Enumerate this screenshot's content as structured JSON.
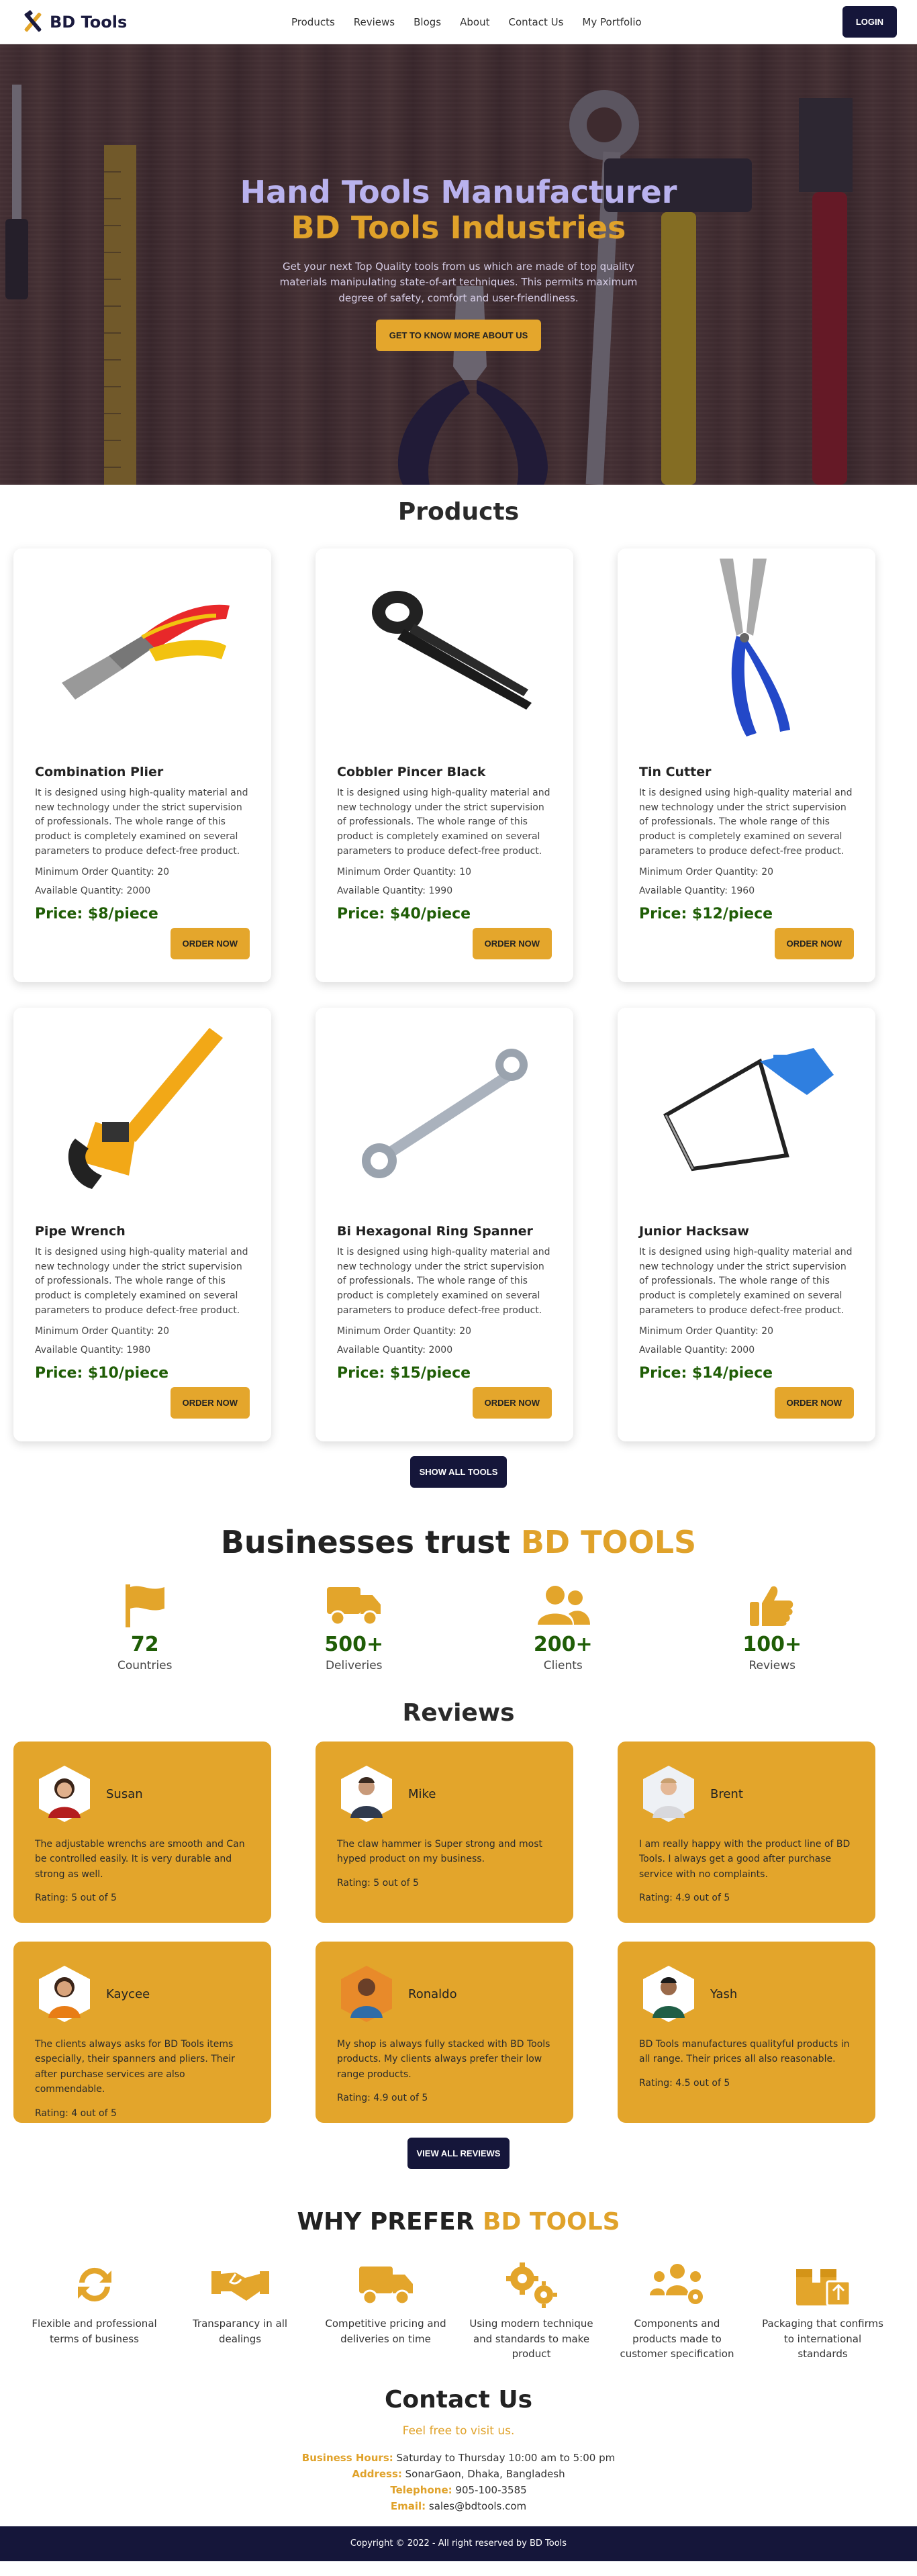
{
  "brand": {
    "name": "BD Tools"
  },
  "nav": {
    "links": [
      "Products",
      "Reviews",
      "Blogs",
      "About",
      "Contact Us",
      "My Portfolio"
    ],
    "login_label": "LOGIN"
  },
  "hero": {
    "title_line1": "Hand Tools Manufacturer",
    "title_line2": "BD Tools Industries",
    "description": "Get your next Top Quality tools from us which are made of top quality materials manipulating state-of-art techniques. This permits maximum degree of safety, comfort and user-friendliness.",
    "cta_label": "GET TO KNOW MORE ABOUT US"
  },
  "products": {
    "title": "Products",
    "order_label": "ORDER NOW",
    "min_order_prefix": "Minimum Order Quantity: ",
    "available_prefix": "Available Quantity: ",
    "description": "It is designed using high-quality material and new technology under the strict supervision of professionals. The whole range of this product is completely examined on several parameters to produce defect-free product.",
    "items": [
      {
        "name": "Combination Plier",
        "min_order": "20",
        "available": "2000",
        "price": "Price: $8/piece",
        "icon": "pliers-image"
      },
      {
        "name": "Cobbler Pincer Black",
        "min_order": "10",
        "available": "1990",
        "price": "Price: $40/piece",
        "icon": "pincer-image"
      },
      {
        "name": "Tin Cutter",
        "min_order": "20",
        "available": "1960",
        "price": "Price: $12/piece",
        "icon": "tin-cutter-image"
      },
      {
        "name": "Pipe Wrench",
        "min_order": "20",
        "available": "1980",
        "price": "Price: $10/piece",
        "icon": "pipe-wrench-image"
      },
      {
        "name": "Bi Hexagonal Ring Spanner",
        "min_order": "20",
        "available": "2000",
        "price": "Price: $15/piece",
        "icon": "ring-spanner-image"
      },
      {
        "name": "Junior Hacksaw",
        "min_order": "20",
        "available": "2000",
        "price": "Price: $14/piece",
        "icon": "hacksaw-image"
      }
    ],
    "show_all_label": "SHOW ALL TOOLS"
  },
  "trust": {
    "title_prefix": "Businesses trust ",
    "title_accent": "BD TOOLS",
    "stats": [
      {
        "value": "72",
        "label": "Countries",
        "icon": "flag-icon"
      },
      {
        "value": "500+",
        "label": "Deliveries",
        "icon": "truck-icon"
      },
      {
        "value": "200+",
        "label": "Clients",
        "icon": "users-icon"
      },
      {
        "value": "100+",
        "label": "Reviews",
        "icon": "thumbs-up-icon"
      }
    ]
  },
  "reviews": {
    "title": "Reviews",
    "items": [
      {
        "name": "Susan",
        "text": "The adjustable wrenchs are smooth and Can be controlled easily. It is very durable and strong as well.",
        "rating": "Rating: 5 out of 5"
      },
      {
        "name": "Mike",
        "text": "The claw hammer is Super strong and most hyped product on my business.",
        "rating": "Rating: 5 out of 5"
      },
      {
        "name": "Brent",
        "text": "I am really happy with the product line of BD Tools. I always get a good after purchase service with no complaints.",
        "rating": "Rating: 4.9 out of 5"
      },
      {
        "name": "Kaycee",
        "text": "The clients always asks for BD Tools items especially, their spanners and pliers. Their after purchase services are also commendable.",
        "rating": "Rating: 4 out of 5"
      },
      {
        "name": "Ronaldo",
        "text": "My shop is always fully stacked with BD Tools products. My clients always prefer their low range products.",
        "rating": "Rating: 4.9 out of 5"
      },
      {
        "name": "Yash",
        "text": "BD Tools manufactures qualityful products in all range. Their prices all also reasonable.",
        "rating": "Rating: 4.5 out of 5"
      }
    ],
    "view_all_label": "VIEW ALL REVIEWS"
  },
  "why": {
    "title_prefix": "WHY PREFER ",
    "title_accent": "BD TOOLS",
    "features": [
      {
        "label": "Flexible and professional terms of business",
        "icon": "refresh-icon"
      },
      {
        "label": "Transparancy in all dealings",
        "icon": "handshake-icon"
      },
      {
        "label": "Competitive pricing and deliveries on time",
        "icon": "truck-icon"
      },
      {
        "label": "Using modern technique and standards to make product",
        "icon": "gears-icon"
      },
      {
        "label": "Components and products made to customer specification",
        "icon": "users-gear-icon"
      },
      {
        "label": "Packaging that confirms to international standards",
        "icon": "package-icon"
      }
    ]
  },
  "contact": {
    "title": "Contact Us",
    "subtitle": "Feel free to visit us.",
    "hours_label": "Business Hours:",
    "hours_value": " Saturday to Thursday 10:00 am to 5:00 pm",
    "address_label": "Address:",
    "address_value": " SonarGaon, Dhaka, Bangladesh",
    "phone_label": "Telephone:",
    "phone_value": " 905-100-3585",
    "email_label": "Email:",
    "email_value": " sales@bdtools.com"
  },
  "footer": {
    "text": "Copyright © 2022 - All right reserved by BD Tools"
  },
  "colors": {
    "accent": "#e3a52b",
    "dark": "#15163a",
    "price": "#1f5d06"
  }
}
